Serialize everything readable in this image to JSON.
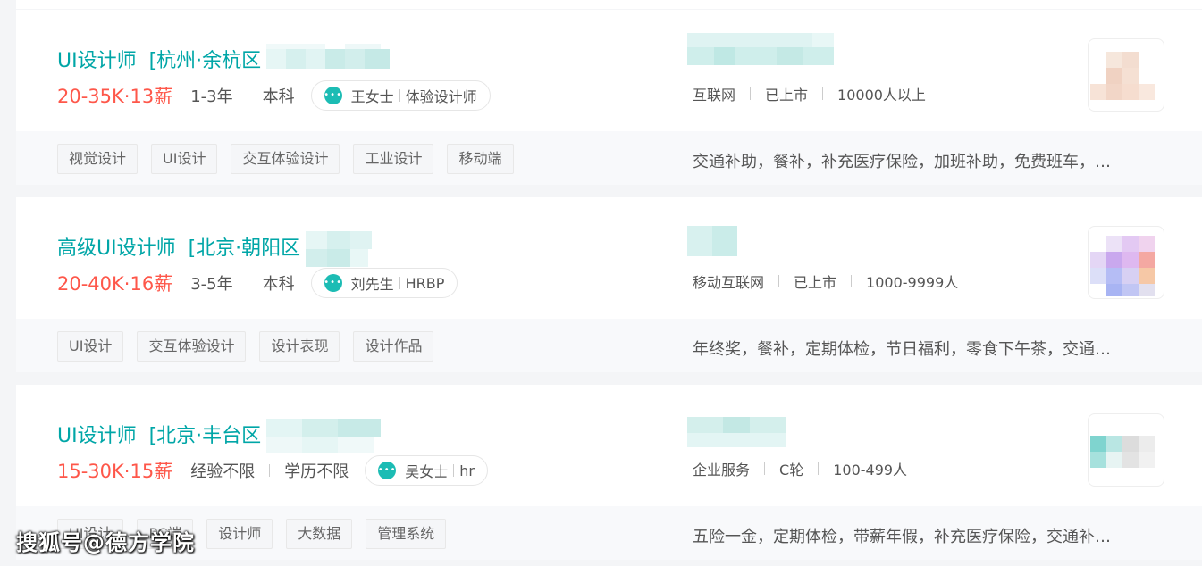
{
  "jobs": [
    {
      "title": "UI设计师",
      "location": "[杭州·余杭区",
      "salary": "20-35K·13薪",
      "experience": "1-3年",
      "education": "本科",
      "recruiter_name": "王女士",
      "recruiter_role": "体验设计师",
      "company_industry": "互联网",
      "company_stage": "已上市",
      "company_size": "10000人以上",
      "tags": [
        "视觉设计",
        "UI设计",
        "交互体验设计",
        "工业设计",
        "移动端"
      ],
      "welfare": "交通补助，餐补，补充医疗保险，加班补助，免费班车，…"
    },
    {
      "title": "高级UI设计师",
      "location": "[北京·朝阳区",
      "salary": "20-40K·16薪",
      "experience": "3-5年",
      "education": "本科",
      "recruiter_name": "刘先生",
      "recruiter_role": "HRBP",
      "company_industry": "移动互联网",
      "company_stage": "已上市",
      "company_size": "1000-9999人",
      "tags": [
        "UI设计",
        "交互体验设计",
        "设计表现",
        "设计作品"
      ],
      "welfare": "年终奖，餐补，定期体检，节日福利，零食下午茶，交通…"
    },
    {
      "title": "UI设计师",
      "location": "[北京·丰台区",
      "salary": "15-30K·15薪",
      "experience": "经验不限",
      "education": "学历不限",
      "recruiter_name": "吴女士",
      "recruiter_role": "hr",
      "company_industry": "企业服务",
      "company_stage": "C轮",
      "company_size": "100-499人",
      "tags": [
        "UI设计",
        "PC端",
        "设计师",
        "大数据",
        "管理系统"
      ],
      "welfare": "五险一金，定期体检，带薪年假，补充医疗保险，交通补…"
    }
  ],
  "watermark": "搜狐号@德方学院",
  "colors": {
    "title": "#00a6a7",
    "salary": "#fe574a",
    "chat_icon": "#1cbcb4"
  },
  "icons": {
    "recruiter": "chat-bubble-icon"
  }
}
